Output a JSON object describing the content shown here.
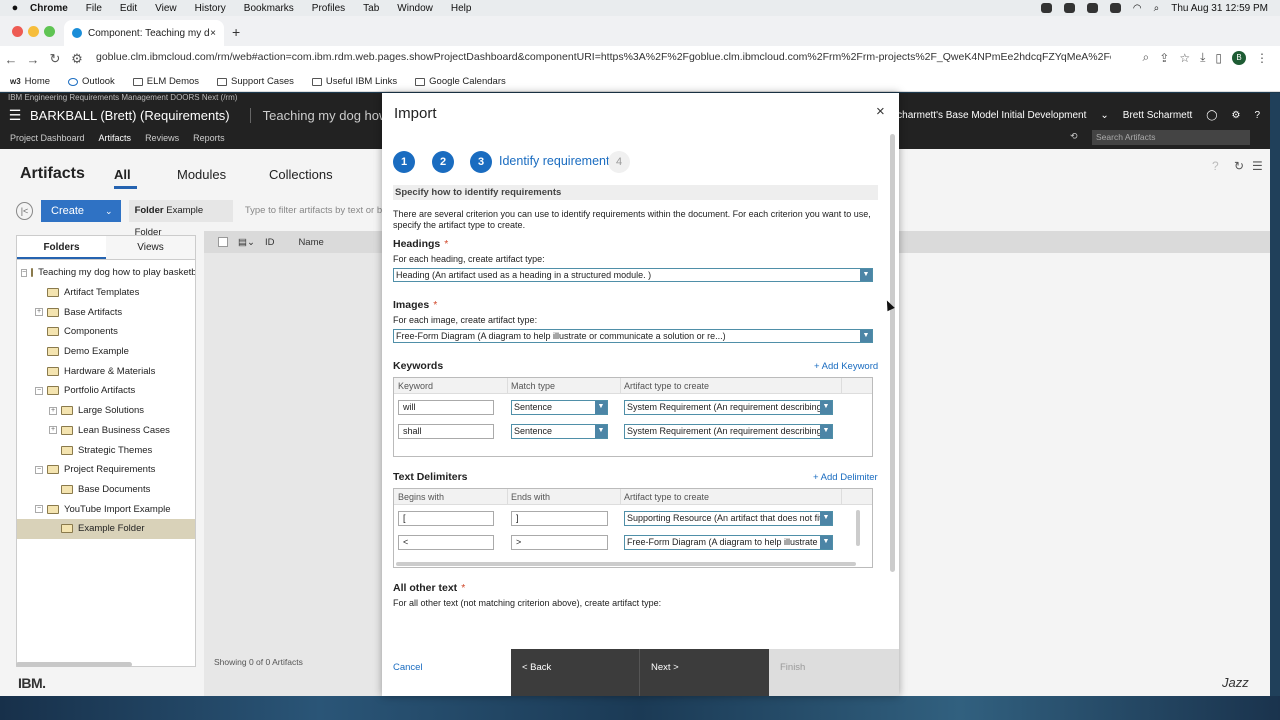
{
  "mac_menu": {
    "apple": "",
    "items": [
      "Chrome",
      "File",
      "Edit",
      "View",
      "History",
      "Bookmarks",
      "Profiles",
      "Tab",
      "Window",
      "Help"
    ],
    "clock": "Thu Aug 31  12:59 PM"
  },
  "browser": {
    "tab_title": "Component: Teaching my dog",
    "url": "goblue.clm.ibmcloud.com/rm/web#action=com.ibm.rdm.web.pages.showProjectDashboard&componentURI=https%3A%2F%2Fgoblue.clm.ibmcloud.com%2Frm%2Frm-projects%2F_QweK4NPmEe2hdcqFZYqMeA%2Fcomponents...",
    "avatar_letter": "B",
    "bookmarks": [
      "Home",
      "Outlook",
      "ELM Demos",
      "Support Cases",
      "Useful IBM Links",
      "Google Calendars"
    ]
  },
  "app": {
    "product": "IBM Engineering Requirements Management DOORS Next (/rm)",
    "project": "BARKBALL (Brett) (Requirements)",
    "component": "Teaching my dog how to pla",
    "config": "tt Scharmett's Base Model Initial Development",
    "user": "Brett Scharmett",
    "subnav": [
      "Project Dashboard",
      "Artifacts",
      "Reviews",
      "Reports"
    ],
    "search_placeholder": "Search Artifacts",
    "artifacts_title": "Artifacts",
    "art_tabs": [
      "All",
      "Modules",
      "Collections"
    ],
    "create_label": "Create",
    "folder_chip_label": "Folder",
    "folder_chip_value": "Example Folder",
    "filter_placeholder": "Type to filter artifacts by text or by ID",
    "panel_tabs": [
      "Folders",
      "Views"
    ],
    "tree": [
      {
        "label": "Teaching my dog how to play basketbal",
        "indent": 0,
        "toggle": "−"
      },
      {
        "label": "Artifact Templates",
        "indent": 1,
        "toggle": ""
      },
      {
        "label": "Base Artifacts",
        "indent": 1,
        "toggle": "+"
      },
      {
        "label": "Components",
        "indent": 1,
        "toggle": ""
      },
      {
        "label": "Demo Example",
        "indent": 1,
        "toggle": ""
      },
      {
        "label": "Hardware & Materials",
        "indent": 1,
        "toggle": ""
      },
      {
        "label": "Portfolio Artifacts",
        "indent": 1,
        "toggle": "−"
      },
      {
        "label": "Large Solutions",
        "indent": 2,
        "toggle": "+"
      },
      {
        "label": "Lean Business Cases",
        "indent": 2,
        "toggle": "+"
      },
      {
        "label": "Strategic Themes",
        "indent": 2,
        "toggle": ""
      },
      {
        "label": "Project Requirements",
        "indent": 1,
        "toggle": "−"
      },
      {
        "label": "Base Documents",
        "indent": 2,
        "toggle": ""
      },
      {
        "label": "YouTube Import Example",
        "indent": 1,
        "toggle": "−"
      },
      {
        "label": "Example Folder",
        "indent": 2,
        "toggle": "",
        "selected": true
      }
    ],
    "grid_cols": [
      "ID",
      "Name"
    ],
    "showing": "Showing 0 of 0 Artifacts",
    "ibm_logo": "IBM.",
    "jazz_logo": "Jazz"
  },
  "dialog": {
    "title": "Import",
    "steps": [
      "1",
      "2",
      "3",
      "4"
    ],
    "current_step_label": "Identify requirements",
    "spec_header": "Specify how to identify requirements",
    "intro": "There are several criterion you can use to identify requirements within the document. For each criterion you want to use, specify the artifact type to create.",
    "headings": {
      "title": "Headings",
      "required": "*",
      "desc": "For each heading, create artifact type:",
      "value": "Heading (An artifact used as a heading in a structured module. )"
    },
    "images": {
      "title": "Images",
      "required": "*",
      "desc": "For each image, create artifact type:",
      "value": "Free-Form Diagram (A diagram to help illustrate or communicate a solution or re...)"
    },
    "keywords": {
      "title": "Keywords",
      "add_label": "+ Add Keyword",
      "cols": [
        "Keyword",
        "Match type",
        "Artifact type to create"
      ],
      "rows": [
        {
          "keyword": "will",
          "match": "Sentence",
          "type": "System Requirement (An requirement describing"
        },
        {
          "keyword": "shall",
          "match": "Sentence",
          "type": "System Requirement (An requirement describing"
        }
      ]
    },
    "delimiters": {
      "title": "Text Delimiters",
      "add_label": "+ Add Delimiter",
      "cols": [
        "Begins with",
        "Ends with",
        "Artifact type to create"
      ],
      "rows": [
        {
          "begins": "[",
          "ends": "]",
          "type": "Supporting Resource (An artifact that does not fit"
        },
        {
          "begins": "<",
          "ends": ">",
          "type": "Free-Form Diagram (A diagram to help illustrate c"
        }
      ]
    },
    "other": {
      "title": "All other text",
      "required": "*",
      "desc": "For all other text (not matching criterion above), create artifact type:"
    },
    "footer": {
      "cancel": "Cancel",
      "back": "< Back",
      "next": "Next >",
      "finish": "Finish"
    }
  },
  "colors": {
    "accent": "#1a6cc0",
    "required": "#d0482a",
    "dark_bar": "#222222",
    "footer_btn": "#3c3c3c"
  }
}
